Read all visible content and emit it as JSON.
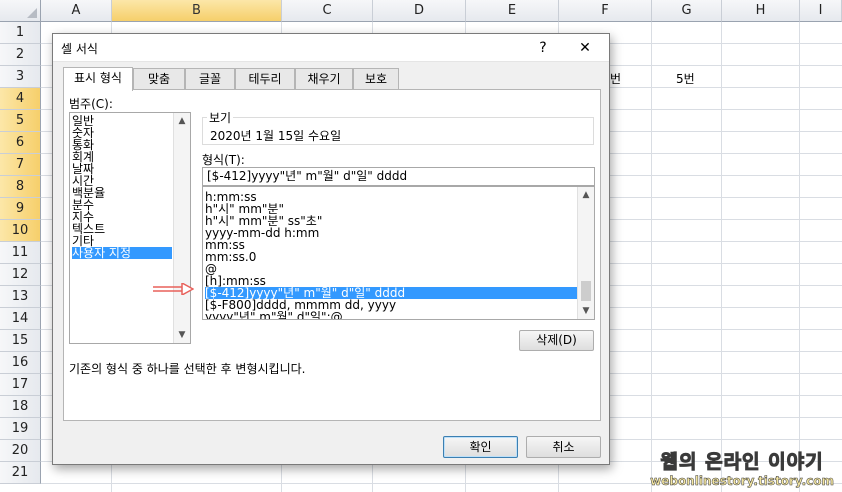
{
  "sheet": {
    "columns": [
      "A",
      "B",
      "C",
      "D",
      "E",
      "F",
      "G",
      "H",
      "I"
    ],
    "rows": [
      "1",
      "2",
      "3",
      "4",
      "5",
      "6",
      "7",
      "8",
      "9",
      "10",
      "11",
      "12",
      "13",
      "14",
      "15",
      "16",
      "17",
      "18",
      "19",
      "20",
      "21"
    ],
    "cells": {
      "f3": "번",
      "g3": "5번"
    }
  },
  "dialog": {
    "title": "셀 서식",
    "help": "?",
    "close": "✕",
    "tabs": [
      "표시 형식",
      "맞춤",
      "글꼴",
      "테두리",
      "채우기",
      "보호"
    ],
    "category_label": "범주(C):",
    "categories": [
      "일반",
      "숫자",
      "통화",
      "회계",
      "날짜",
      "시간",
      "백분율",
      "분수",
      "지수",
      "텍스트",
      "기타",
      "사용자 지정"
    ],
    "selected_category": "사용자 지정",
    "sample_label": "보기",
    "sample_value": "2020년 1월 15일 수요일",
    "type_label": "형식(T):",
    "type_value": "[$-412]yyyy\"년\" m\"월\" d\"일\" dddd",
    "formats": [
      "h:mm:ss",
      "h\"시\" mm\"분\"",
      "h\"시\" mm\"분\" ss\"초\"",
      "yyyy-mm-dd h:mm",
      "mm:ss",
      "mm:ss.0",
      "@",
      "[h]:mm:ss",
      "[$-412]yyyy\"년\" m\"월\" d\"일\" dddd",
      "[$-F800]dddd, mmmm dd, yyyy",
      "yyyy\"년\" m\"월\" d\"일\";@"
    ],
    "selected_format": "[$-412]yyyy\"년\" m\"월\" d\"일\" dddd",
    "delete_button": "삭제(D)",
    "description": "기존의 형식 중 하나를 선택한 후 변형시킵니다.",
    "ok_button": "확인",
    "cancel_button": "취소"
  },
  "watermark": {
    "line1": "웹의 온라인 이야기",
    "line2": "webonlinestory.tistory.com"
  },
  "colors": {
    "selection": "#3399ff",
    "header_selected": "#f6cf6b",
    "annotation_arrow": "#e8605a"
  }
}
